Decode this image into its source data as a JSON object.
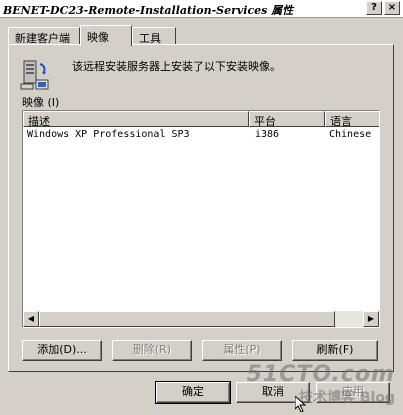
{
  "window": {
    "title": "BENET-DC23-Remote-Installation-Services 属性",
    "help_glyph": "?",
    "close_glyph": "×"
  },
  "tabs": [
    {
      "label": "新建客户端"
    },
    {
      "label": "映像",
      "active": true
    },
    {
      "label": "工具"
    }
  ],
  "panel": {
    "icon": "server-icon",
    "description": "该远程安装服务器上安装了以下安装映像。",
    "list_label": "映像 (I)"
  },
  "listview": {
    "columns": [
      "描述",
      "平台",
      "语言"
    ],
    "rows": [
      {
        "description": "Windows XP Professional SP3",
        "platform": "i386",
        "language": "Chinese"
      }
    ]
  },
  "buttons": {
    "add": "添加(D)...",
    "remove": "删除(R)",
    "properties": "属性(P)",
    "refresh": "刷新(F)"
  },
  "footer": {
    "ok": "确定",
    "cancel": "取消",
    "apply": "应用"
  },
  "watermark": {
    "site": "51CTO.com",
    "sub": "技术博客 Blog"
  }
}
